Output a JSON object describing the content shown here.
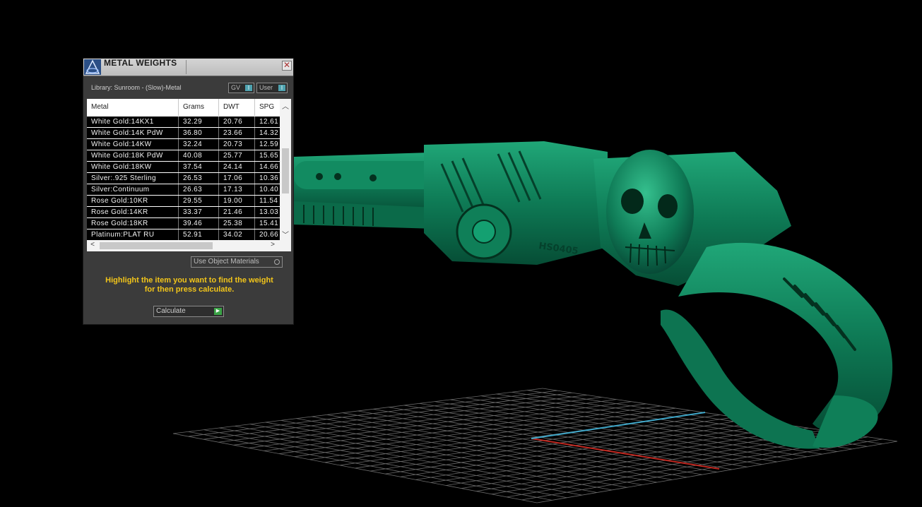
{
  "window": {
    "title": "METAL WEIGHTS",
    "close_glyph": "✕"
  },
  "library": {
    "label": "Library: Sunroom - (Slow)-Metal"
  },
  "toggles": {
    "gv_label": "GV",
    "user_label": "User"
  },
  "table": {
    "columns": [
      "Metal",
      "Grams",
      "DWT",
      "SPG"
    ],
    "rows": [
      [
        "White Gold:14KX1",
        "32.29",
        "20.76",
        "12.61"
      ],
      [
        "White Gold:14K PdW",
        "36.80",
        "23.66",
        "14.32"
      ],
      [
        "White Gold:14KW",
        "32.24",
        "20.73",
        "12.59"
      ],
      [
        "White Gold:18K PdW",
        "40.08",
        "25.77",
        "15.65"
      ],
      [
        "White Gold:18KW",
        "37.54",
        "24.14",
        "14.66"
      ],
      [
        "Silver:.925 Sterling",
        "26.53",
        "17.06",
        "10.36"
      ],
      [
        "Silver:Continuum",
        "26.63",
        "17.13",
        "10.40"
      ],
      [
        "Rose Gold:10KR",
        "29.55",
        "19.00",
        "11.54"
      ],
      [
        "Rose Gold:14KR",
        "33.37",
        "21.46",
        "13.03"
      ],
      [
        "Rose Gold:18KR",
        "39.46",
        "25.38",
        "15.41"
      ],
      [
        "Platinum:PLAT RU",
        "52.91",
        "34.02",
        "20.66"
      ]
    ]
  },
  "object_materials": {
    "label": "Use Object Materials"
  },
  "hint": {
    "line1": "Highlight the item you want to find the weight",
    "line2": "for then press calculate."
  },
  "calculate": {
    "label": "Calculate"
  },
  "scene": {
    "model_color": "#0e7a55",
    "background": "#000000",
    "model_engraving": "HS0405",
    "axis_colors": {
      "x": "#c0271f",
      "y": "#3fa7c9"
    }
  }
}
